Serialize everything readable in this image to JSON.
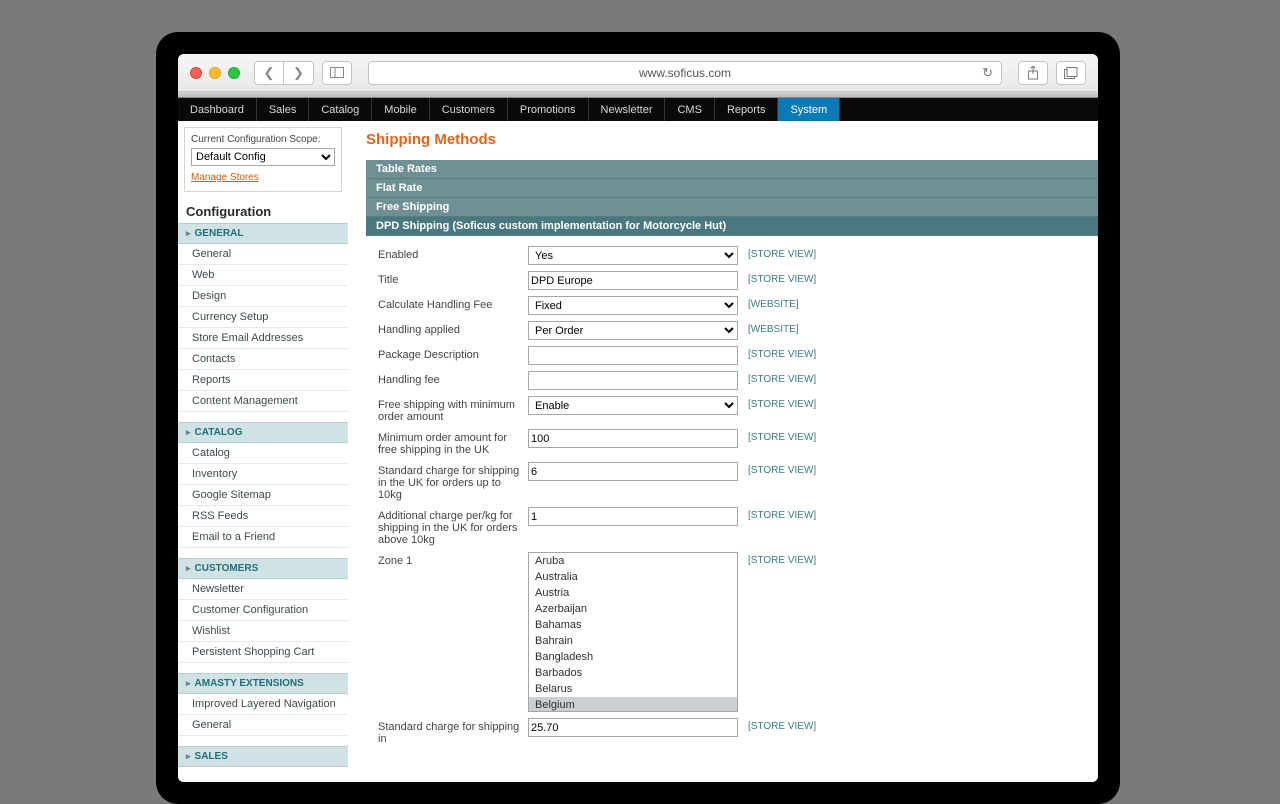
{
  "browser": {
    "url": "www.soficus.com"
  },
  "topnav": {
    "items": [
      "Dashboard",
      "Sales",
      "Catalog",
      "Mobile",
      "Customers",
      "Promotions",
      "Newsletter",
      "CMS",
      "Reports",
      "System"
    ],
    "active": "System"
  },
  "scope": {
    "label": "Current Configuration Scope:",
    "value": "Default Config",
    "manage": "Manage Stores"
  },
  "config_heading": "Configuration",
  "sections": [
    {
      "title": "GENERAL",
      "items": [
        "General",
        "Web",
        "Design",
        "Currency Setup",
        "Store Email Addresses",
        "Contacts",
        "Reports",
        "Content Management"
      ]
    },
    {
      "title": "CATALOG",
      "items": [
        "Catalog",
        "Inventory",
        "Google Sitemap",
        "RSS Feeds",
        "Email to a Friend"
      ]
    },
    {
      "title": "CUSTOMERS",
      "items": [
        "Newsletter",
        "Customer Configuration",
        "Wishlist",
        "Persistent Shopping Cart"
      ]
    },
    {
      "title": "AMASTY EXTENSIONS",
      "items": [
        "Improved Layered Navigation",
        "General"
      ]
    },
    {
      "title": "SALES",
      "items": []
    }
  ],
  "page_title": "Shipping Methods",
  "accordion": [
    "Table Rates",
    "Flat Rate",
    "Free Shipping",
    "DPD Shipping (Soficus custom implementation for Motorcycle Hut)"
  ],
  "form": {
    "enabled": {
      "label": "Enabled",
      "value": "Yes",
      "scope": "[STORE VIEW]"
    },
    "title": {
      "label": "Title",
      "value": "DPD Europe",
      "scope": "[STORE VIEW]"
    },
    "calc_fee": {
      "label": "Calculate Handling Fee",
      "value": "Fixed",
      "scope": "[WEBSITE]"
    },
    "handling_applied": {
      "label": "Handling applied",
      "value": "Per Order",
      "scope": "[WEBSITE]"
    },
    "package_desc": {
      "label": "Package Description",
      "value": "",
      "scope": "[STORE VIEW]"
    },
    "handling_fee": {
      "label": "Handling fee",
      "value": "",
      "scope": "[STORE VIEW]"
    },
    "free_ship_min": {
      "label": "Free shipping with minimum order amount",
      "value": "Enable",
      "scope": "[STORE VIEW]"
    },
    "min_order_uk": {
      "label": "Minimum order amount for free shipping in the UK",
      "value": "100",
      "scope": "[STORE VIEW]"
    },
    "std_charge_uk": {
      "label": "Standard charge for shipping in the UK for orders up to 10kg",
      "value": "6",
      "scope": "[STORE VIEW]"
    },
    "addl_charge_uk": {
      "label": "Additional charge per/kg for shipping in the UK for orders above 10kg",
      "value": "1",
      "scope": "[STORE VIEW]"
    },
    "zone1": {
      "label": "Zone 1",
      "scope": "[STORE VIEW]",
      "options": [
        "Aruba",
        "Australia",
        "Austria",
        "Azerbaijan",
        "Bahamas",
        "Bahrain",
        "Bangladesh",
        "Barbados",
        "Belarus",
        "Belgium"
      ],
      "selected": "Belgium"
    },
    "std_charge_zone": {
      "label": "Standard charge for shipping in",
      "value": "25.70",
      "scope": "[STORE VIEW]"
    }
  }
}
